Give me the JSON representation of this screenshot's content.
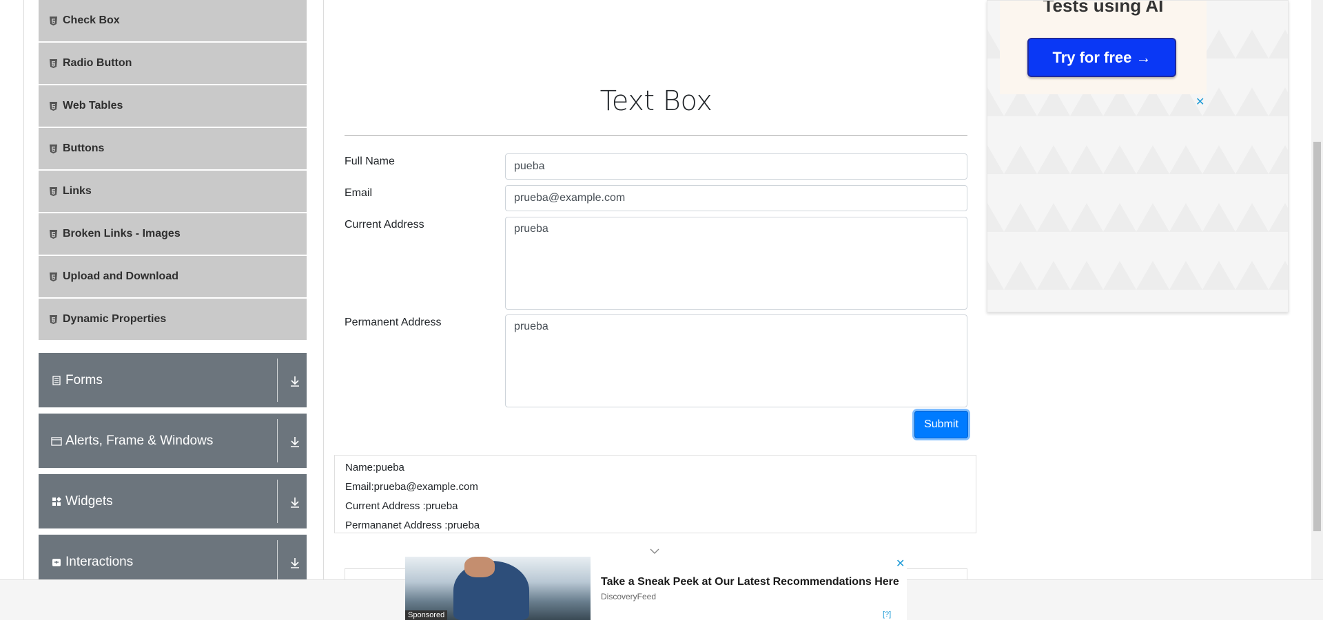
{
  "sidebar": {
    "sub_items": [
      {
        "label": "Check Box"
      },
      {
        "label": "Radio Button"
      },
      {
        "label": "Web Tables"
      },
      {
        "label": "Buttons"
      },
      {
        "label": "Links"
      },
      {
        "label": "Broken Links - Images"
      },
      {
        "label": "Upload and Download"
      },
      {
        "label": "Dynamic Properties"
      }
    ],
    "groups": [
      {
        "label": "Forms",
        "icon": "form-icon"
      },
      {
        "label": "Alerts, Frame & Windows",
        "icon": "window-icon"
      },
      {
        "label": "Widgets",
        "icon": "widgets-icon"
      },
      {
        "label": "Interactions",
        "icon": "interactions-icon"
      }
    ]
  },
  "main": {
    "title": "Text Box",
    "form": {
      "full_name_label": "Full Name",
      "full_name_value": "pueba",
      "email_label": "Email",
      "email_value": "prueba@example.com",
      "current_address_label": "Current Address",
      "current_address_value": "prueba",
      "permanent_address_label": "Permanent Address",
      "permanent_address_value": "prueba",
      "submit_label": "Submit"
    },
    "output": {
      "name": "Name:pueba",
      "email": "Email:prueba@example.com",
      "current_address": "Current Address :prueba",
      "permanent_address": "Permananet Address :prueba"
    }
  },
  "ad_right": {
    "heading": "Tests using AI",
    "button_label": "Try for free →",
    "close": "✕"
  },
  "sponsored": {
    "tag": "Sponsored",
    "headline": "Take a Sneak Peek at Our Latest Recommendations Here",
    "source": "DiscoveryFeed",
    "help": "[?]",
    "close": "✕"
  },
  "colors": {
    "sub_item_bg": "#c9c9c9",
    "group_bg": "#6c757d",
    "submit_bg": "#007bff",
    "ad_button_bg": "#0a38f5"
  }
}
